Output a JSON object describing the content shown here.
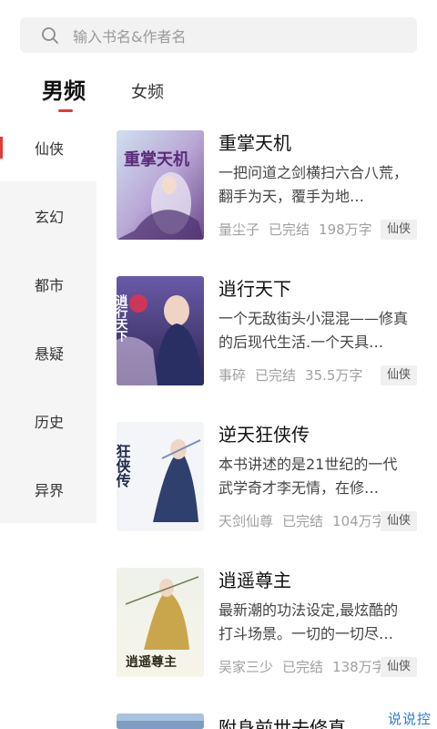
{
  "search": {
    "placeholder": "输入书名&作者名",
    "icon": "search-icon"
  },
  "tabs": [
    {
      "label": "男频",
      "active": true
    },
    {
      "label": "女频",
      "active": false
    }
  ],
  "categories": [
    {
      "label": "仙侠",
      "active": true
    },
    {
      "label": "玄幻"
    },
    {
      "label": "都市"
    },
    {
      "label": "悬疑"
    },
    {
      "label": "历史"
    },
    {
      "label": "异界"
    }
  ],
  "books": [
    {
      "title": "重掌天机",
      "desc": "一把问道之剑横扫六合八荒，翻手为天，覆手为地…",
      "author": "量尘子",
      "status": "已完结",
      "words": "198万字",
      "tag": "仙侠",
      "cover_text": "重掌天机"
    },
    {
      "title": "逍行天下",
      "desc": "一个无敌街头小混混——修真的后现代生活.一个天具…",
      "author": "事碎",
      "status": "已完结",
      "words": "35.5万字",
      "tag": "仙侠",
      "cover_text": "逍行天下"
    },
    {
      "title": "逆天狂侠传",
      "desc": "本书讲述的是21世纪的一代武学奇才李无情，在修…",
      "author": "天剑仙尊",
      "status": "已完结",
      "words": "104万字",
      "tag": "仙侠",
      "cover_text": "狂侠传"
    },
    {
      "title": "逍遥尊主",
      "desc": "最新潮的功法设定,最炫酷的打斗场景。一切的一切尽…",
      "author": "吴家三少",
      "status": "已完结",
      "words": "138万字",
      "tag": "仙侠",
      "cover_text": "逍遥尊主"
    },
    {
      "title": "附身前世去修真"
    }
  ],
  "watermark": "说说控",
  "colors": {
    "accent": "#e53935",
    "sidebar_bg": "#f5f5f5",
    "search_bg": "#f2f2f2"
  }
}
